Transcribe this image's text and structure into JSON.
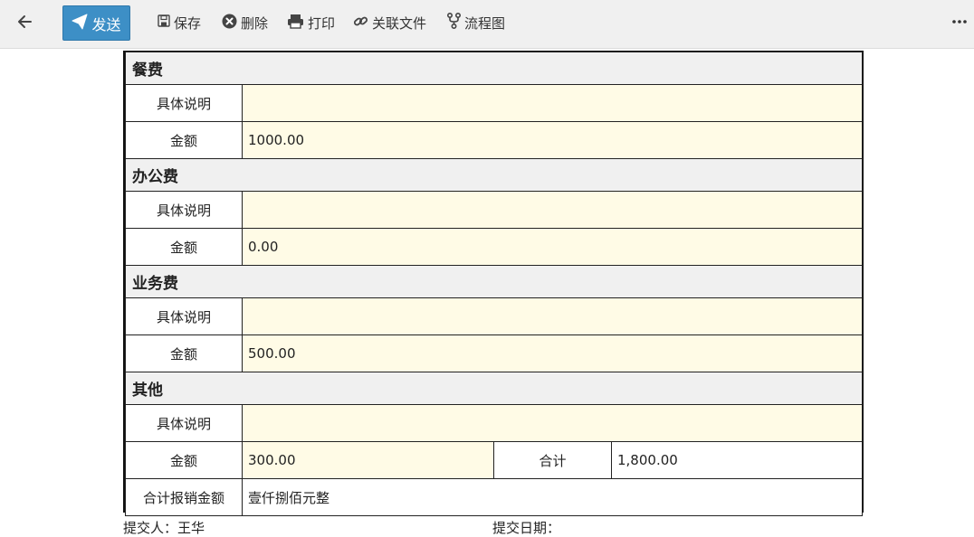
{
  "toolbar": {
    "send_label": "发送",
    "save_label": "保存",
    "delete_label": "删除",
    "print_label": "打印",
    "linkfile_label": "关联文件",
    "flowchart_label": "流程图"
  },
  "sections": [
    {
      "title": "餐费",
      "desc_label": "具体说明",
      "desc_value": "",
      "amount_label": "金额",
      "amount_value": "1000.00"
    },
    {
      "title": "办公费",
      "desc_label": "具体说明",
      "desc_value": "",
      "amount_label": "金额",
      "amount_value": "0.00"
    },
    {
      "title": "业务费",
      "desc_label": "具体说明",
      "desc_value": "",
      "amount_label": "金额",
      "amount_value": "500.00"
    },
    {
      "title": "其他",
      "desc_label": "具体说明",
      "desc_value": "",
      "amount_label": "金额",
      "amount_value": "300.00"
    }
  ],
  "total": {
    "label": "合计",
    "value": "1,800.00"
  },
  "grand_total": {
    "label": "合计报销金额",
    "value": "壹仟捌佰元整"
  },
  "footer": {
    "submitter_label": "提交人：",
    "submitter_name": "王华",
    "date_label": "提交日期："
  },
  "colors": {
    "accent": "#3d8fc6",
    "field_bg": "#fffbe6",
    "section_bg": "#f0f0f0"
  }
}
